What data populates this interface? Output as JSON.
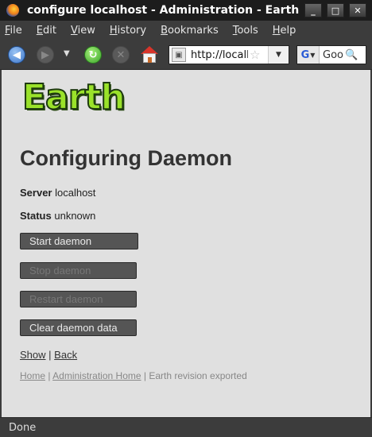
{
  "window": {
    "title": "configure localhost - Administration - Earth - Mozilla Firefox",
    "minimize_symbol": "_",
    "maximize_symbol": "□",
    "close_symbol": "✕"
  },
  "menubar": {
    "items": [
      "File",
      "Edit",
      "View",
      "History",
      "Bookmarks",
      "Tools",
      "Help"
    ]
  },
  "toolbar": {
    "url": "http://localhost",
    "search_placeholder": "Google",
    "search_engine_letter": "G"
  },
  "icons": {
    "back": "back-arrow-icon",
    "forward": "forward-arrow-icon",
    "reload": "reload-icon",
    "stop": "stop-icon",
    "home": "home-icon",
    "bookmark_star": "star-icon",
    "search": "magnifier-icon"
  },
  "page": {
    "logo_text": "Earth",
    "title": "Configuring Daemon",
    "server_label": "Server",
    "server_value": "localhost",
    "status_label": "Status",
    "status_value": "unknown",
    "buttons": [
      {
        "label": "Start daemon",
        "enabled": true
      },
      {
        "label": "Stop daemon",
        "enabled": false
      },
      {
        "label": "Restart daemon",
        "enabled": false
      },
      {
        "label": "Clear daemon data",
        "enabled": true
      }
    ],
    "links": {
      "show": "Show",
      "separator": "|",
      "back": "Back"
    },
    "footer": {
      "home": "Home",
      "separator": "|",
      "admin_home": "Administration Home",
      "revision_text": "Earth revision exported"
    }
  },
  "statusbar": {
    "text": "Done"
  },
  "colors": {
    "content_bg": "#e0e0e0",
    "chrome_bg": "#3c3c3c",
    "logo_green": "#9ae22a",
    "button_bg": "#555555"
  }
}
